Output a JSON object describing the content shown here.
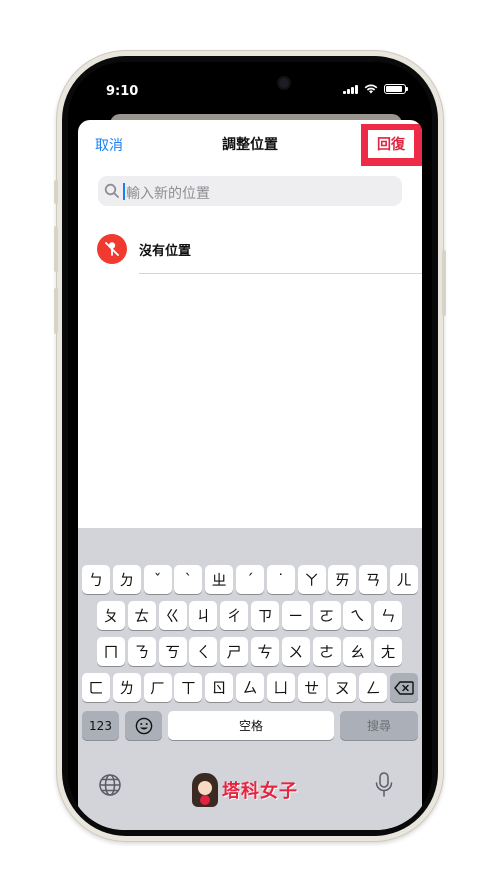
{
  "status": {
    "time": "9:10"
  },
  "nav": {
    "cancel": "取消",
    "title": "調整位置",
    "revert": "回復"
  },
  "search": {
    "placeholder": "輸入新的位置"
  },
  "location": {
    "label": "沒有位置"
  },
  "keyboard": {
    "row1": [
      "ㄅ",
      "ㄉ",
      "ˇ",
      "ˋ",
      "ㄓ",
      "ˊ",
      "˙",
      "ㄚ",
      "ㄞ",
      "ㄢ",
      "ㄦ"
    ],
    "row2": [
      "ㄆ",
      "ㄊ",
      "ㄍ",
      "ㄐ",
      "ㄔ",
      "ㄗ",
      "ㄧ",
      "ㄛ",
      "ㄟ",
      "ㄣ"
    ],
    "row3": [
      "ㄇ",
      "ㄋ",
      "ㄎ",
      "ㄑ",
      "ㄕ",
      "ㄘ",
      "ㄨ",
      "ㄜ",
      "ㄠ",
      "ㄤ"
    ],
    "row4": [
      "ㄈ",
      "ㄌ",
      "ㄏ",
      "ㄒ",
      "ㄖ",
      "ㄙ",
      "ㄩ",
      "ㄝ",
      "ㄡ",
      "ㄥ"
    ],
    "numbers": "123",
    "space": "空格",
    "search": "搜尋"
  },
  "watermark": {
    "text": "塔科女子"
  },
  "colors": {
    "accent": "#1a7ff5",
    "highlight": "#ee2b46",
    "location_icon": "#f03a2f",
    "keyboard_bg": "#d2d4d9"
  },
  "icons": [
    "search-icon",
    "location-off-icon",
    "emoji-icon",
    "delete-icon",
    "globe-icon",
    "microphone-icon"
  ]
}
